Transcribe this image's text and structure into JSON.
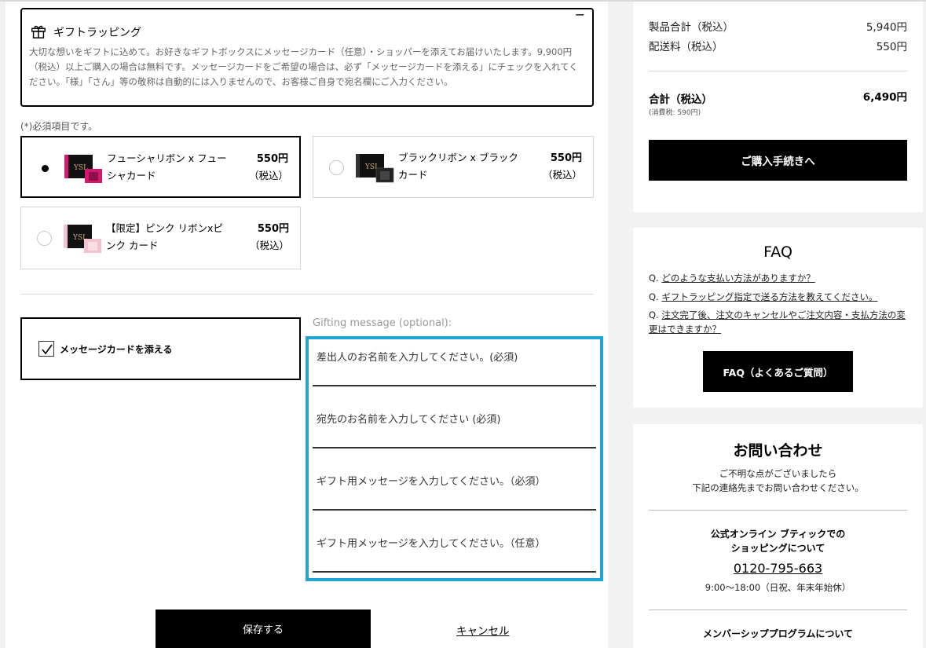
{
  "gift": {
    "title": "ギフトラッピング",
    "collapse_icon": "minus-icon",
    "description": "大切な想いをギフトに込めて。お好きなギフトボックスにメッセージカード（任意）・ショッパーを添えてお届けいたします。9,900円（税込）以上ご購入の場合は無料です。メッセージカードをご希望の場合は、必ず「メッセージカードを添える」にチェックを入れてください。「様」「さん」等の敬称は自動的には入りませんので、お客様ご自身で宛名欄にご入力ください。",
    "required_note": "(*)必須項目です。",
    "options": [
      {
        "name": "フューシャリボン x フューシャカード",
        "price": "550円",
        "tax": "（税込）",
        "selected": true,
        "accent": "#d4176f"
      },
      {
        "name": "ブラックリボン x ブラックカード",
        "price": "550円",
        "tax": "（税込）",
        "selected": false,
        "accent": "#222222"
      },
      {
        "name": "【限定】ピンク リボンxピンク カード",
        "price": "550円",
        "tax": "（税込）",
        "selected": false,
        "accent": "#f2c3cf"
      }
    ]
  },
  "message": {
    "checkbox_label": "メッセージカードを添える",
    "checked": true,
    "gifting_label": "Gifting message (optional):",
    "fields": [
      {
        "placeholder": "差出人のお名前を入力してください。(必須)"
      },
      {
        "placeholder": "宛先のお名前を入力してください (必須)"
      },
      {
        "placeholder": "ギフト用メッセージを入力してください。（必須）"
      },
      {
        "placeholder": "ギフト用メッセージを入力してください。（任意）"
      }
    ]
  },
  "actions": {
    "save_label": "保存する",
    "cancel_label": "キャンセル"
  },
  "summary": {
    "subtotal_label": "製品合計（税込）",
    "subtotal_value": "5,940円",
    "shipping_label": "配送料（税込）",
    "shipping_value": "550円",
    "total_label": "合計（税込）",
    "total_value": "6,490円",
    "tax_note": "(消費税: 590円)",
    "checkout_label": "ご購入手続きへ"
  },
  "faq": {
    "title": "FAQ",
    "questions": [
      {
        "prefix": "Q. ",
        "text": "どのような支払い方法がありますか？"
      },
      {
        "prefix": "Q. ",
        "text": "ギフトラッピング指定で送る方法を教えてください。"
      },
      {
        "prefix": "Q. ",
        "text": "注文完了後、注文のキャンセルやご注文内容・支払方法の変更はできますか？"
      }
    ],
    "button_label": "FAQ（よくあるご質問）"
  },
  "contact": {
    "title": "お問い合わせ",
    "desc_line1": "ご不明な点がございましたら",
    "desc_line2": "下記の連絡先までお問い合わせください。",
    "sub_line1": "公式オンライン ブティックでの",
    "sub_line2": "ショッピングについて",
    "phone": "0120-795-663",
    "hours": "9:00〜18:00（日祝、年末年始休）",
    "member": "メンバーシッププログラムについて"
  },
  "colors": {
    "highlight": "#22a5d8",
    "primary": "#000000"
  }
}
